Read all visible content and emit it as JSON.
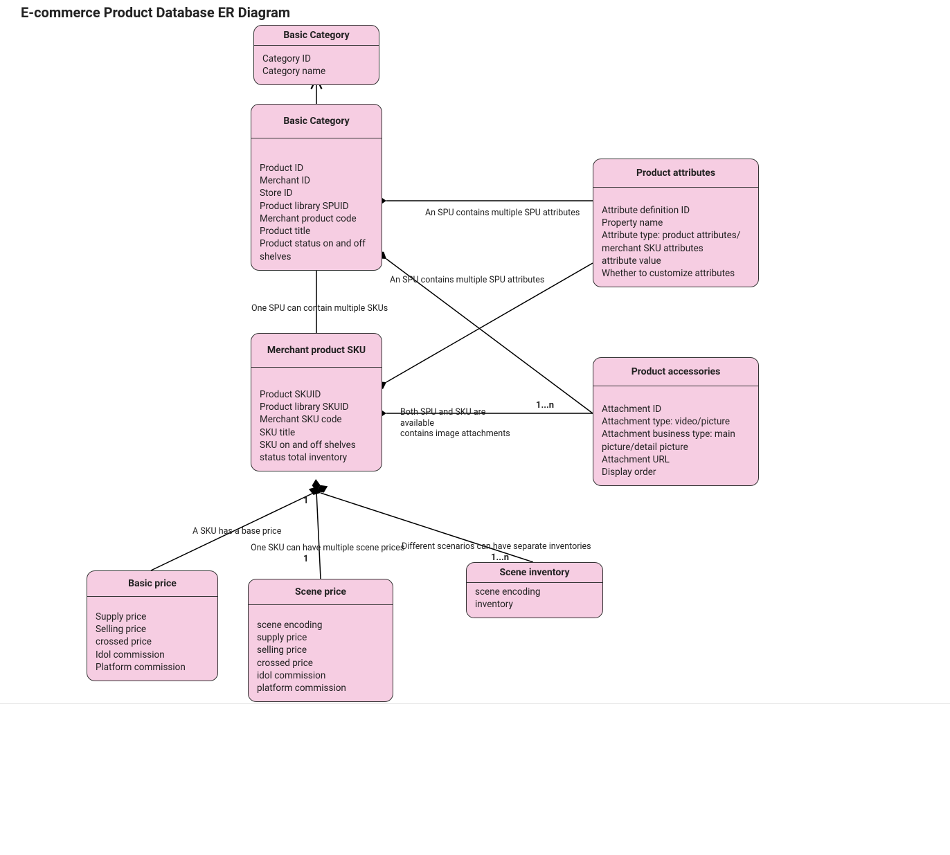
{
  "title": "E-commerce Product Database ER Diagram",
  "entities": {
    "basic_category_top": {
      "name": "Basic Category",
      "attrs": [
        "Category ID",
        "Category name"
      ]
    },
    "basic_category_main": {
      "name": "Basic Category",
      "attrs": [
        "Product ID",
        "Merchant ID",
        "Store ID",
        "Product library SPUID",
        "Merchant product code",
        "Product title",
        "Product status on and off shelves"
      ]
    },
    "product_attributes": {
      "name": "Product attributes",
      "attrs": [
        "Attribute definition ID",
        "Property name",
        "Attribute type: product attributes/ merchant SKU attributes",
        "attribute value",
        "Whether to customize attributes"
      ]
    },
    "merchant_sku": {
      "name": "Merchant product SKU",
      "attrs": [
        "Product SKUID",
        "Product library SKUID",
        "Merchant SKU code",
        "SKU title",
        "SKU on and off shelves status total inventory"
      ]
    },
    "product_accessories": {
      "name": "Product accessories",
      "attrs": [
        "Attachment ID",
        "Attachment type: video/picture",
        "Attachment business type: main picture/detail picture",
        "Attachment URL",
        "Display order"
      ]
    },
    "basic_price": {
      "name": "Basic price",
      "attrs": [
        "Supply price",
        "Selling price",
        "crossed price",
        "Idol commission",
        "Platform commission"
      ]
    },
    "scene_price": {
      "name": "Scene price",
      "attrs": [
        "scene encoding",
        "supply price",
        "selling price",
        "crossed price",
        "idol commission",
        "platform commission"
      ]
    },
    "scene_inventory": {
      "name": "Scene inventory",
      "attrs": [
        "scene encoding",
        "inventory"
      ]
    }
  },
  "labels": {
    "l_spu_to_attrs": "An SPU contains multiple SPU attributes",
    "l_sku_to_attrs": "An SPU contains multiple SPU attributes",
    "l_spu_to_skus": "One SPU can contain multiple SKUs",
    "l_accessories_note_1": "Both SPU and SKU are available",
    "l_accessories_note_2": "contains image attachments",
    "l_basic_price": "A SKU has a base price",
    "l_scene_price": "One SKU can have multiple scene prices",
    "l_scene_inv": "Different scenarios can have separate inventories"
  },
  "mults": {
    "m_sku_lower": "1",
    "m_scene_price_upper": "1",
    "m_accessories": "1...n",
    "m_scene_inv": "1...n"
  }
}
